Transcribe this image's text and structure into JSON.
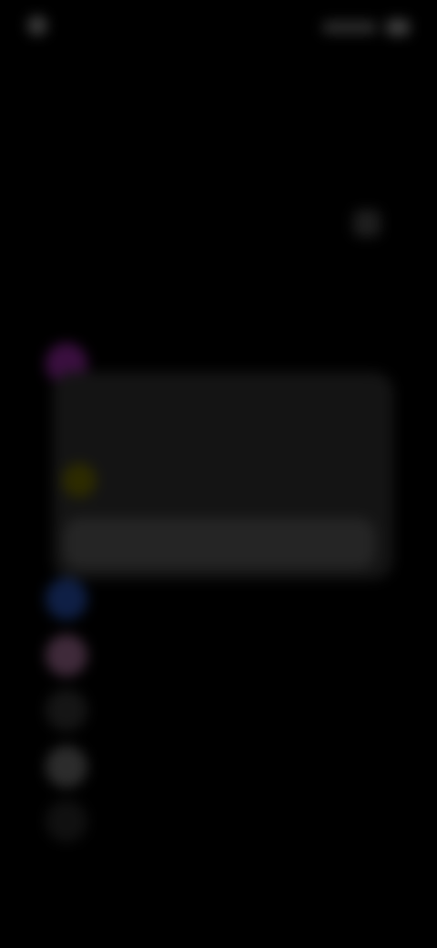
{
  "status_bar": {
    "time": "",
    "carrier": ""
  },
  "header": {
    "subtitle": "",
    "title": "",
    "left_action": ""
  },
  "apps": [
    {
      "name": "",
      "icon": "app-icon-purple",
      "color": "#3a0f3f"
    },
    {
      "name": "",
      "icon": "app-icon-blue",
      "color": "#0f1f45"
    },
    {
      "name": "",
      "icon": "app-icon-pink",
      "color": "#3f2a3a"
    },
    {
      "name": "",
      "icon": "app-icon-dark",
      "color": "#151515"
    },
    {
      "name": "",
      "icon": "app-icon-gray",
      "color": "#2c2c2c"
    },
    {
      "name": "",
      "icon": "app-icon-dim",
      "color": "#101010"
    }
  ],
  "card": {
    "heading": "",
    "text": "",
    "button_label": ""
  },
  "colors": {
    "background": "#000000",
    "card": "#141414",
    "button": "#252525"
  }
}
